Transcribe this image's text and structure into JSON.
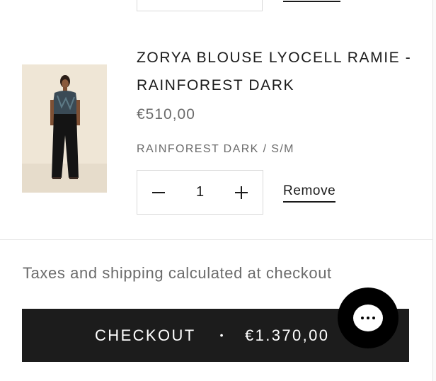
{
  "cart_item": {
    "title": "ZORYA BLOUSE LYOCELL RAMIE - RAINFOREST DARK",
    "price": "€510,00",
    "variant": "RAINFOREST DARK / S/M",
    "quantity": "1",
    "decrease_icon": "minus-icon",
    "increase_icon": "plus-icon",
    "remove_label": "Remove",
    "image_alt": "model-wearing-blouse-photo"
  },
  "footer": {
    "taxes_note": "Taxes and shipping calculated at checkout",
    "checkout_label": "CHECKOUT",
    "separator": "•",
    "checkout_total": "€1.370,00"
  },
  "chat": {
    "icon": "chat-bubble-icon"
  },
  "colors": {
    "checkout_bg": "#1c1c1c",
    "text_primary": "#1a1a1a",
    "text_muted": "#6b6b6b",
    "chat_bg": "#000000"
  }
}
